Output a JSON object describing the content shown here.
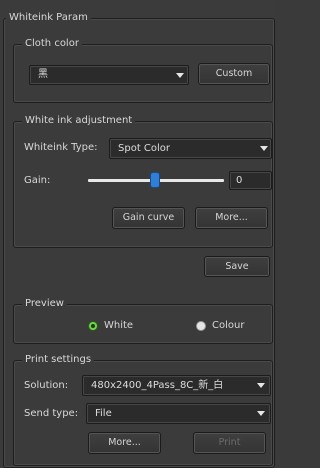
{
  "window": {
    "title": "Whiteink Param"
  },
  "cloth": {
    "legend": "Cloth color",
    "selected": "黑",
    "custom_label": "Custom"
  },
  "white_ink": {
    "legend": "White ink adjustment",
    "type_label": "Whiteink Type:",
    "type_value": "Spot Color",
    "gain_label": "Gain:",
    "gain_value": "0",
    "gain_curve_label": "Gain curve",
    "more_label": "More..."
  },
  "save_label": "Save",
  "preview": {
    "legend": "Preview",
    "white_label": "White",
    "colour_label": "Colour",
    "selected": "White"
  },
  "print_settings": {
    "legend": "Print settings",
    "solution_label": "Solution:",
    "solution_value": "480x2400_4Pass_8C_新_白",
    "send_type_label": "Send type:",
    "send_type_value": "File",
    "more_label": "More...",
    "print_label": "Print"
  },
  "colors": {
    "background": "#3b3b3b",
    "radio_selected": "#6fd34a",
    "slider_handle": "#2f7fd6"
  }
}
